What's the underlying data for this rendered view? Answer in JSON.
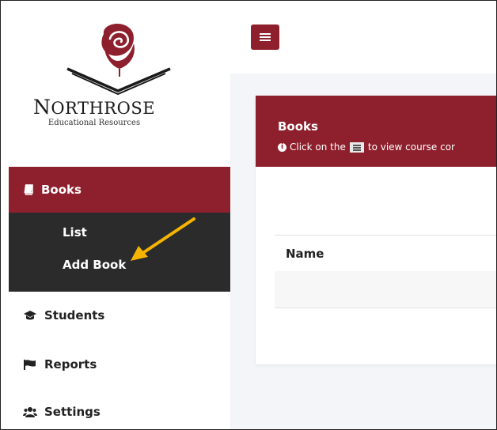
{
  "brand": {
    "name_initial": "N",
    "name_rest": "ORTHROSE",
    "tagline": "Educational Resources",
    "accent_color": "#8e1f2c"
  },
  "sidebar": {
    "active": {
      "label": "Books",
      "icon": "book-icon"
    },
    "submenu": [
      {
        "label": "List"
      },
      {
        "label": "Add Book"
      }
    ],
    "items": [
      {
        "label": "Students",
        "icon": "graduation-cap-icon"
      },
      {
        "label": "Reports",
        "icon": "flag-icon"
      },
      {
        "label": "Settings",
        "icon": "users-icon"
      }
    ]
  },
  "main": {
    "menu_button_icon": "hamburger-icon",
    "card": {
      "title": "Books",
      "hint_before": "Click on the",
      "hint_after": "to view course cor"
    },
    "table": {
      "columns": [
        "Name"
      ]
    }
  },
  "annotation": {
    "arrow_color": "#f5b400"
  }
}
